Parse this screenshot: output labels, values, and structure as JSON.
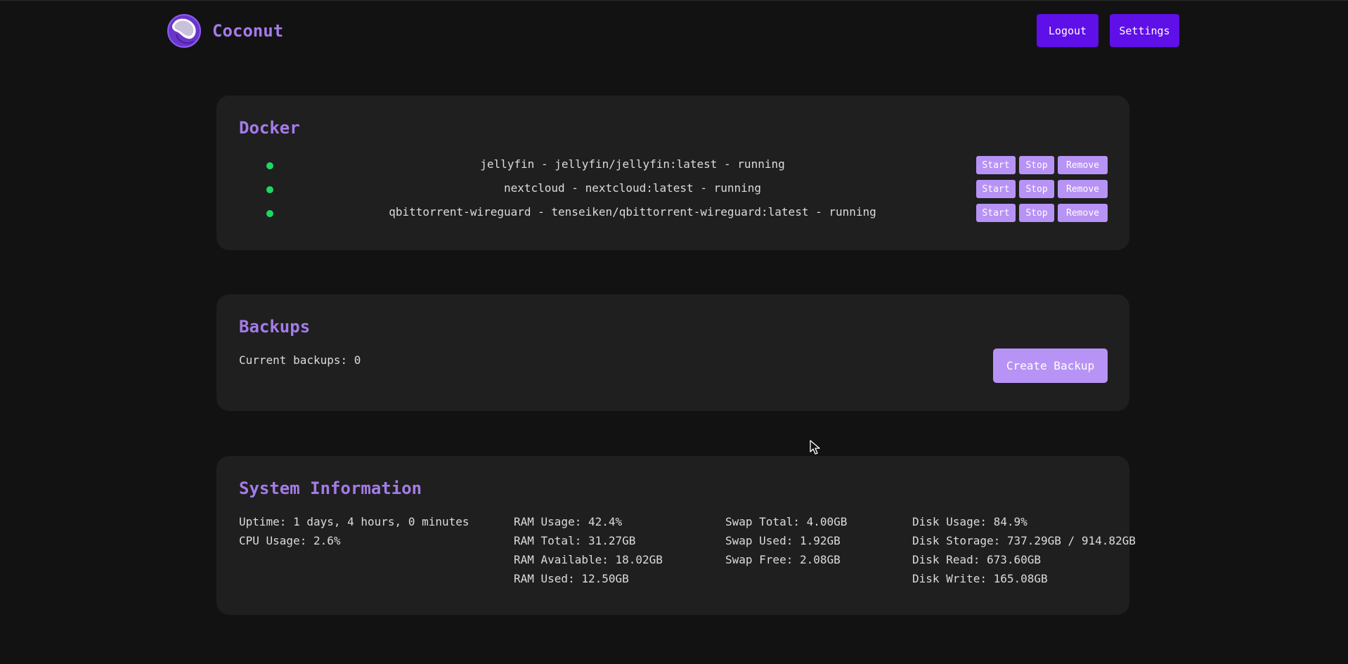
{
  "header": {
    "app_name": "Coconut",
    "logo_icon": "coconut-logo-icon",
    "logout_label": "Logout",
    "settings_label": "Settings",
    "accent_color": "#5f0fe8"
  },
  "docker": {
    "title": "Docker",
    "containers": [
      {
        "text": "jellyfin - jellyfin/jellyfin:latest - running",
        "status_color": "#1ed760"
      },
      {
        "text": "nextcloud - nextcloud:latest - running",
        "status_color": "#1ed760"
      },
      {
        "text": "qbittorrent-wireguard - tenseiken/qbittorrent-wireguard:latest - running",
        "status_color": "#1ed760"
      }
    ],
    "start_label": "Start",
    "stop_label": "Stop",
    "remove_label": "Remove"
  },
  "backups": {
    "title": "Backups",
    "count_text": "Current backups: 0",
    "create_label": "Create Backup"
  },
  "system": {
    "title": "System Information",
    "col1": [
      "Uptime: 1 days, 4 hours, 0 minutes",
      "CPU Usage: 2.6%"
    ],
    "col2": [
      "RAM Usage: 42.4%",
      "RAM Total: 31.27GB",
      "RAM Available: 18.02GB",
      "RAM Used: 12.50GB"
    ],
    "col3": [
      "Swap Total: 4.00GB",
      "Swap Used: 1.92GB",
      "Swap Free: 2.08GB"
    ],
    "col4": [
      "Disk Usage: 84.9%",
      "Disk Storage: 737.29GB / 914.82GB",
      "Disk Read: 673.60GB",
      "Disk Write: 165.08GB"
    ]
  },
  "colors": {
    "background": "#121212",
    "card": "#1f1f1f",
    "title_purple": "#a47ce8",
    "button_light_purple": "#b793f5"
  }
}
